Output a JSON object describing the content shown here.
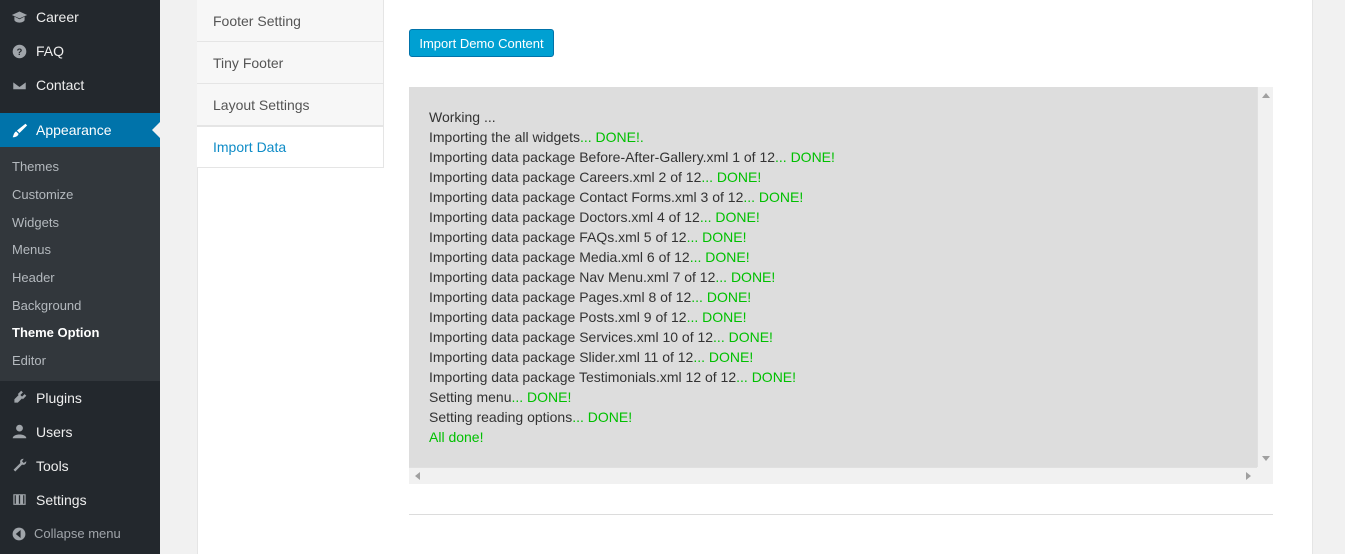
{
  "sidebar": {
    "top_items": [
      {
        "label": "Career",
        "icon": "mortarboard-icon"
      },
      {
        "label": "FAQ",
        "icon": "question-icon"
      },
      {
        "label": "Contact",
        "icon": "envelope-icon"
      }
    ],
    "active": {
      "label": "Appearance",
      "icon": "brush-icon"
    },
    "submenu": [
      "Themes",
      "Customize",
      "Widgets",
      "Menus",
      "Header",
      "Background",
      "Theme Option",
      "Editor"
    ],
    "current_submenu": "Theme Option",
    "bottom_items": [
      {
        "label": "Plugins",
        "icon": "plug-icon"
      },
      {
        "label": "Users",
        "icon": "user-icon"
      },
      {
        "label": "Tools",
        "icon": "wrench-icon"
      },
      {
        "label": "Settings",
        "icon": "sliders-icon"
      }
    ],
    "collapse_label": "Collapse menu"
  },
  "tabs": [
    "Footer Setting",
    "Tiny Footer",
    "Layout Settings",
    "Import Data"
  ],
  "active_tab": "Import Data",
  "import_button_label": "Import Demo Content",
  "log": [
    {
      "text": "Working ...",
      "done": ""
    },
    {
      "text": "Importing the all widgets",
      "done": "... DONE!."
    },
    {
      "text": "Importing data package Before-After-Gallery.xml 1 of 12",
      "done": "... DONE!"
    },
    {
      "text": "Importing data package Careers.xml 2 of 12",
      "done": "... DONE!"
    },
    {
      "text": "Importing data package Contact Forms.xml 3 of 12",
      "done": "... DONE!"
    },
    {
      "text": "Importing data package Doctors.xml 4 of 12",
      "done": "... DONE!"
    },
    {
      "text": "Importing data package FAQs.xml 5 of 12",
      "done": "... DONE!"
    },
    {
      "text": "Importing data package Media.xml 6 of 12",
      "done": "... DONE!"
    },
    {
      "text": "Importing data package Nav Menu.xml 7 of 12",
      "done": "... DONE!"
    },
    {
      "text": "Importing data package Pages.xml 8 of 12",
      "done": "... DONE!"
    },
    {
      "text": "Importing data package Posts.xml 9 of 12",
      "done": "... DONE!"
    },
    {
      "text": "Importing data package Services.xml 10 of 12",
      "done": "... DONE!"
    },
    {
      "text": "Importing data package Slider.xml 11 of 12",
      "done": "... DONE!"
    },
    {
      "text": "Importing data package Testimonials.xml 12 of 12",
      "done": "... DONE!"
    },
    {
      "text": "Setting menu",
      "done": "... DONE!"
    },
    {
      "text": "Setting reading options",
      "done": "... DONE!"
    },
    {
      "text": "",
      "done": "All done!"
    }
  ],
  "colors": {
    "accent": "#0073aa",
    "button": "#00a0d2",
    "done": "#00c000",
    "sidebar": "#23282d"
  }
}
